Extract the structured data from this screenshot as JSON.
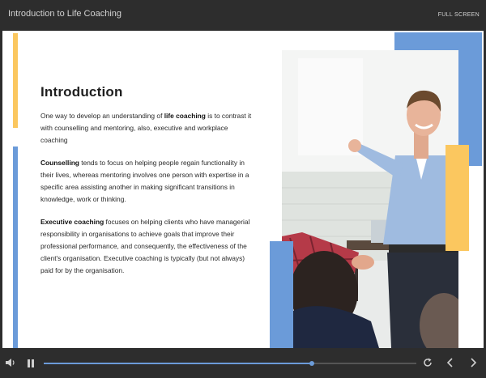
{
  "header": {
    "title": "Introduction to Life Coaching",
    "fullscreen_label": "FULL SCREEN"
  },
  "slide": {
    "heading": "Introduction",
    "paragraphs": [
      {
        "before": "One way to develop an understanding of ",
        "bold": "life coaching",
        "after": " is to contrast it with counselling and mentoring, also, executive and workplace coaching"
      },
      {
        "bold": "Counselling",
        "after": " tends to focus on helping people regain functionality in their lives, whereas mentoring involves one person with expertise in a specific area assisting another in making significant transitions in knowledge, work or thinking."
      },
      {
        "bold": "Executive coaching",
        "after": " focuses on helping clients who have managerial responsibility in organisations to achieve goals that improve their professional performance, and consequently, the effectiveness of the client's organisation. Executive coaching is typically (but not always) paid for by the organisation."
      }
    ]
  },
  "player": {
    "progress_fraction": 0.72
  },
  "colors": {
    "accent_blue": "#6b9bd9",
    "accent_yellow": "#fbc75f",
    "chrome_bg": "#2d2d2d"
  },
  "icons": [
    "volume-icon",
    "pause-icon",
    "replay-icon",
    "prev-icon",
    "next-icon"
  ]
}
